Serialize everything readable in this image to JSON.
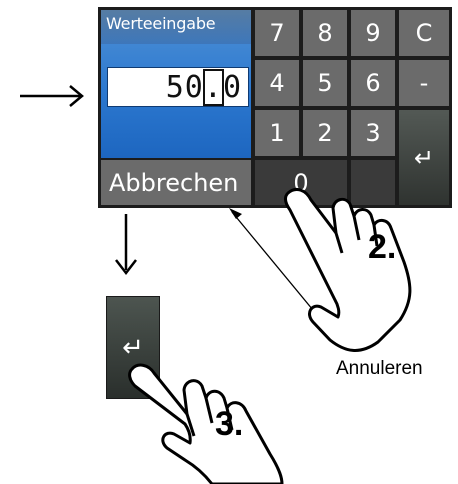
{
  "dialog": {
    "title": "Werteeingabe",
    "value_before": "50",
    "value_cursor": ".",
    "value_after": "0"
  },
  "keys": {
    "k7": "7",
    "k8": "8",
    "k9": "9",
    "clear": "C",
    "k4": "4",
    "k5": "5",
    "k6": "6",
    "minus": "-",
    "k1": "1",
    "k2": "2",
    "k3": "3",
    "k0": "0",
    "cancel": "Abbrechen",
    "enter_symbol": "↵"
  },
  "annotations": {
    "cancel_callout": "Annuleren",
    "step2": "2.",
    "step3": "3."
  }
}
